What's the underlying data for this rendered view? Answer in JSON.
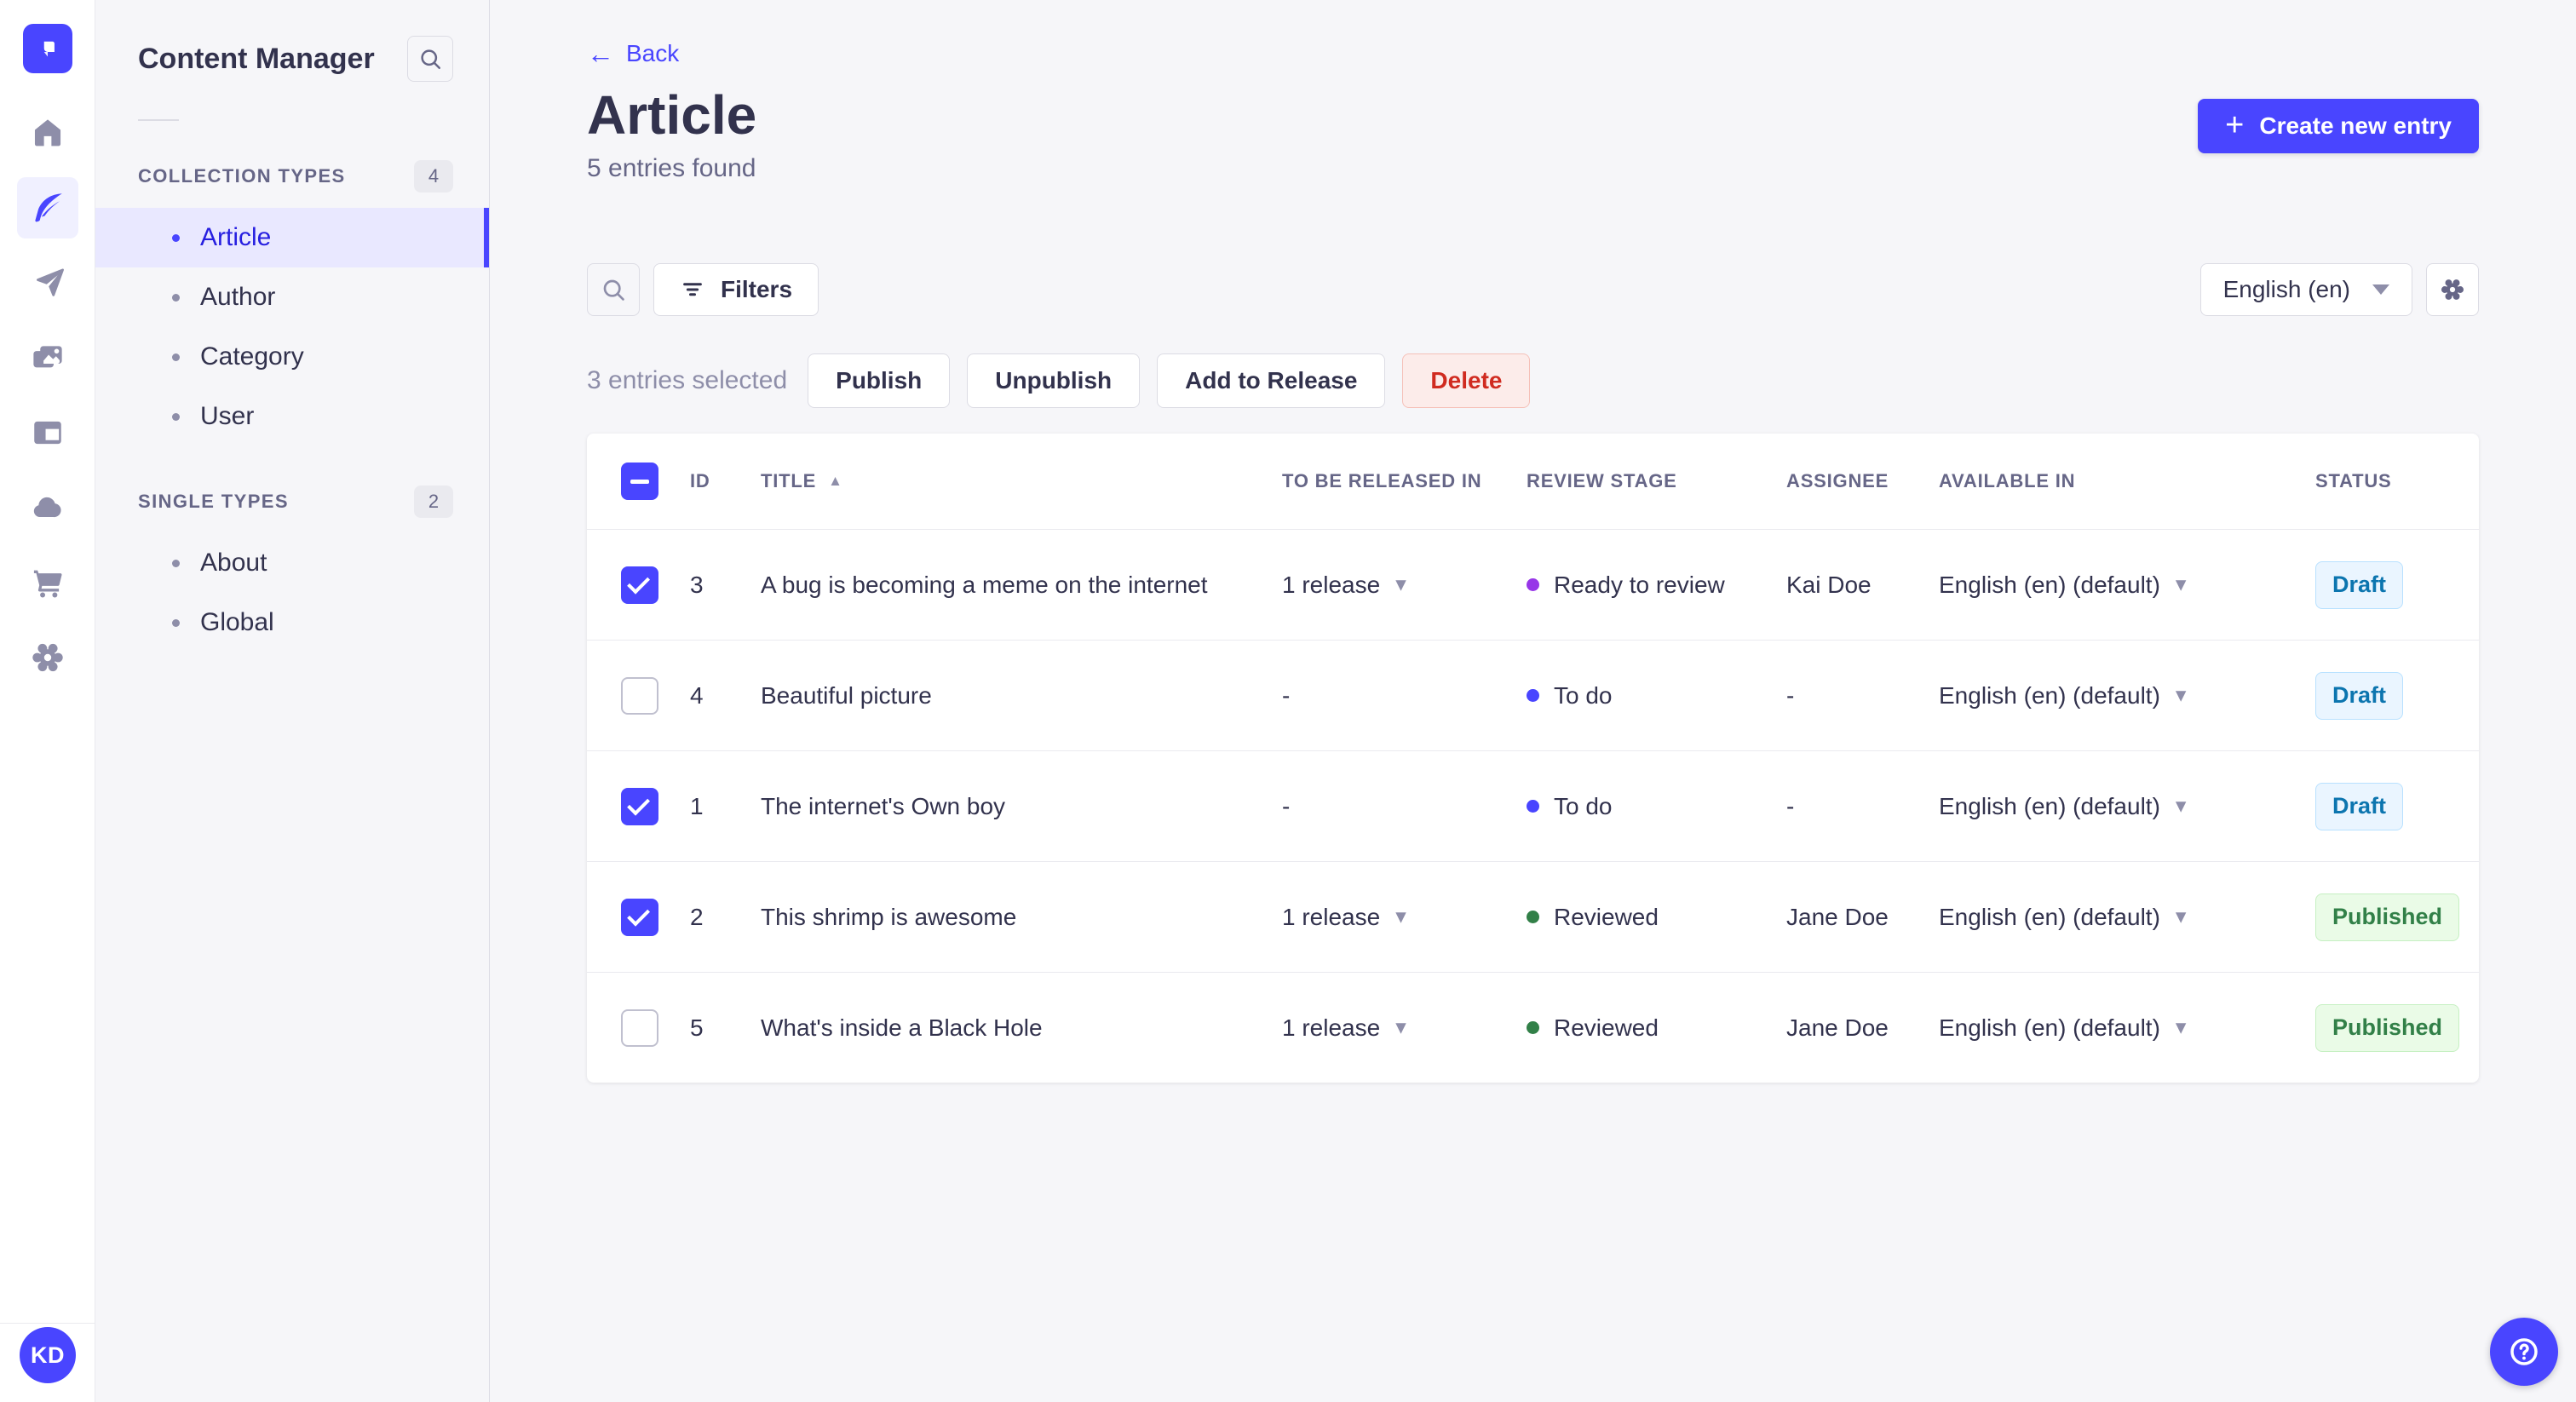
{
  "colors": {
    "primary": "#4945ff",
    "active_item_text": "#271fe0",
    "active_item_bg": "#e9e8ff",
    "page_bg": "#f6f6f9",
    "text_dark": "#32324d",
    "text_gray": "#666687",
    "icon_gray": "#8e8ea9",
    "draft_badge_text": "#0c75af",
    "published_badge_text": "#328048",
    "delete_text": "#d02b20",
    "stage_purple": "#9736e8",
    "stage_blue": "#4945ff",
    "stage_green": "#328048"
  },
  "nav": {
    "avatar_initials": "KD"
  },
  "subnav": {
    "title": "Content Manager",
    "sections": [
      {
        "label": "COLLECTION TYPES",
        "count": "4",
        "items": [
          {
            "label": "Article"
          },
          {
            "label": "Author"
          },
          {
            "label": "Category"
          },
          {
            "label": "User"
          }
        ]
      },
      {
        "label": "SINGLE TYPES",
        "count": "2",
        "items": [
          {
            "label": "About"
          },
          {
            "label": "Global"
          }
        ]
      }
    ]
  },
  "header": {
    "back_label": "Back",
    "title": "Article",
    "subtitle": "5 entries found",
    "create_button": "Create new entry"
  },
  "toolbar": {
    "filters_label": "Filters",
    "locale_value": "English (en)"
  },
  "selection": {
    "text": "3 entries selected",
    "publish_label": "Publish",
    "unpublish_label": "Unpublish",
    "add_to_release_label": "Add to Release",
    "delete_label": "Delete"
  },
  "icons": {
    "back_arrow": "←",
    "plus": "+",
    "caret_down": "▾",
    "sort_asc": "▲"
  },
  "table": {
    "headers": [
      "ID",
      "TITLE",
      "TO BE RELEASED IN",
      "REVIEW STAGE",
      "ASSIGNEE",
      "AVAILABLE IN",
      "STATUS"
    ],
    "rows": [
      {
        "checked": true,
        "id": "3",
        "title": "A bug is becoming a meme on the internet",
        "release": "1 release",
        "release_caret": "▾",
        "stage_color": "purple",
        "review_stage": "Ready to review",
        "assignee": "Kai Doe",
        "available": "English (en) (default)",
        "status": "Draft"
      },
      {
        "checked": false,
        "id": "4",
        "title": "Beautiful picture",
        "release": "-",
        "release_caret": "",
        "stage_color": "blue",
        "review_stage": "To do",
        "assignee": "-",
        "available": "English (en) (default)",
        "status": "Draft"
      },
      {
        "checked": true,
        "id": "1",
        "title": "The internet's Own boy",
        "release": "-",
        "release_caret": "",
        "stage_color": "blue",
        "review_stage": "To do",
        "assignee": "-",
        "available": "English (en) (default)",
        "status": "Draft"
      },
      {
        "checked": true,
        "id": "2",
        "title": "This shrimp is awesome",
        "release": "1 release",
        "release_caret": "▾",
        "stage_color": "green",
        "review_stage": "Reviewed",
        "assignee": "Jane Doe",
        "available": "English (en) (default)",
        "status": "Published"
      },
      {
        "checked": false,
        "id": "5",
        "title": "What's inside a Black Hole",
        "release": "1 release",
        "release_caret": "▾",
        "stage_color": "green",
        "review_stage": "Reviewed",
        "assignee": "Jane Doe",
        "available": "English (en) (default)",
        "status": "Published"
      }
    ]
  }
}
